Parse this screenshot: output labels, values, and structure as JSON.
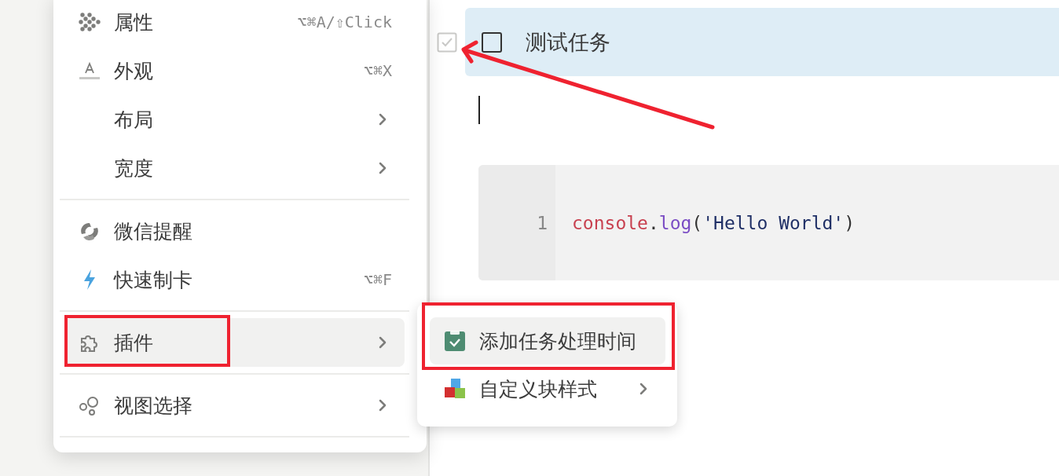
{
  "menu": {
    "sections": [
      {
        "items": [
          {
            "label": "属性",
            "shortcut": "⌥⌘A/⇧Click",
            "has_submenu": false,
            "selected": false
          },
          {
            "label": "外观",
            "shortcut": "⌥⌘X",
            "has_submenu": false,
            "selected": false
          },
          {
            "label": "布局",
            "has_submenu": true,
            "selected": false
          },
          {
            "label": "宽度",
            "has_submenu": true,
            "selected": false
          }
        ]
      },
      {
        "items": [
          {
            "label": "微信提醒",
            "has_submenu": false,
            "selected": false
          },
          {
            "label": "快速制卡",
            "shortcut": "⌥⌘F",
            "has_submenu": false,
            "selected": false
          }
        ]
      },
      {
        "items": [
          {
            "label": "插件",
            "has_submenu": true,
            "selected": true
          }
        ]
      },
      {
        "items": [
          {
            "label": "视图选择",
            "has_submenu": true,
            "selected": false
          }
        ]
      }
    ]
  },
  "submenu": {
    "items": [
      {
        "label": "添加任务处理时间",
        "has_submenu": false,
        "selected": true
      },
      {
        "label": "自定义块样式",
        "has_submenu": true,
        "selected": false
      }
    ]
  },
  "editor": {
    "task": {
      "label": "测试任务",
      "checked": false
    },
    "code_block": {
      "lines": [
        {
          "number": "1",
          "text": "console.log('Hello World')"
        }
      ]
    }
  }
}
